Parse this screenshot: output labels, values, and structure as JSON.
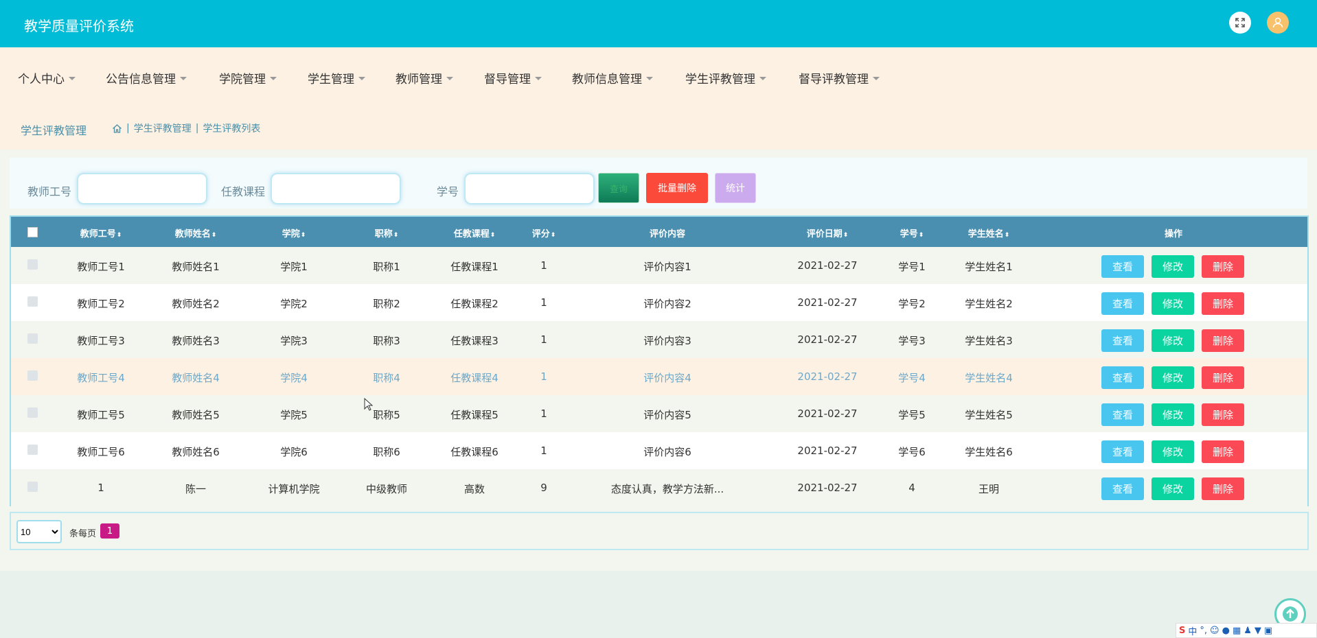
{
  "app": {
    "title": "教学质量评价系统"
  },
  "nav": [
    {
      "label": "个人中心"
    },
    {
      "label": "公告信息管理"
    },
    {
      "label": "学院管理"
    },
    {
      "label": "学生管理"
    },
    {
      "label": "教师管理"
    },
    {
      "label": "督导管理"
    },
    {
      "label": "教师信息管理"
    },
    {
      "label": "学生评教管理"
    },
    {
      "label": "督导评教管理"
    }
  ],
  "breadcrumb": {
    "title": "学生评教管理",
    "level1": "学生评教管理",
    "level2": "学生评教列表"
  },
  "search": {
    "teacher_no_label": "教师工号",
    "course_label": "任教课程",
    "student_no_label": "学号",
    "query_label": "查询",
    "batch_delete_label": "批量删除",
    "stats_label": "统计"
  },
  "table": {
    "headers": {
      "teacher_no": "教师工号",
      "teacher_name": "教师姓名",
      "college": "学院",
      "title": "职称",
      "course": "任教课程",
      "score": "评分",
      "content": "评价内容",
      "date": "评价日期",
      "student_no": "学号",
      "student_name": "学生姓名",
      "actions": "操作"
    },
    "actions": {
      "view": "查看",
      "edit": "修改",
      "delete": "删除"
    },
    "rows": [
      {
        "teacher_no": "教师工号1",
        "teacher_name": "教师姓名1",
        "college": "学院1",
        "title": "职称1",
        "course": "任教课程1",
        "score": "1",
        "content": "评价内容1",
        "date": "2021-02-27",
        "student_no": "学号1",
        "student_name": "学生姓名1"
      },
      {
        "teacher_no": "教师工号2",
        "teacher_name": "教师姓名2",
        "college": "学院2",
        "title": "职称2",
        "course": "任教课程2",
        "score": "1",
        "content": "评价内容2",
        "date": "2021-02-27",
        "student_no": "学号2",
        "student_name": "学生姓名2"
      },
      {
        "teacher_no": "教师工号3",
        "teacher_name": "教师姓名3",
        "college": "学院3",
        "title": "职称3",
        "course": "任教课程3",
        "score": "1",
        "content": "评价内容3",
        "date": "2021-02-27",
        "student_no": "学号3",
        "student_name": "学生姓名3"
      },
      {
        "teacher_no": "教师工号4",
        "teacher_name": "教师姓名4",
        "college": "学院4",
        "title": "职称4",
        "course": "任教课程4",
        "score": "1",
        "content": "评价内容4",
        "date": "2021-02-27",
        "student_no": "学号4",
        "student_name": "学生姓名4"
      },
      {
        "teacher_no": "教师工号5",
        "teacher_name": "教师姓名5",
        "college": "学院5",
        "title": "职称5",
        "course": "任教课程5",
        "score": "1",
        "content": "评价内容5",
        "date": "2021-02-27",
        "student_no": "学号5",
        "student_name": "学生姓名5"
      },
      {
        "teacher_no": "教师工号6",
        "teacher_name": "教师姓名6",
        "college": "学院6",
        "title": "职称6",
        "course": "任教课程6",
        "score": "1",
        "content": "评价内容6",
        "date": "2021-02-27",
        "student_no": "学号6",
        "student_name": "学生姓名6"
      },
      {
        "teacher_no": "1",
        "teacher_name": "陈一",
        "college": "计算机学院",
        "title": "中级教师",
        "course": "高数",
        "score": "9",
        "content": "态度认真，教学方法新...",
        "date": "2021-02-27",
        "student_no": "4",
        "student_name": "王明"
      }
    ]
  },
  "pagination": {
    "page_size": "10",
    "per_page_label": "条每页",
    "current_page": "1"
  },
  "colors": {
    "topbar": "#00bcd6",
    "header_row": "#4a8fb0",
    "view": "#48c6f0",
    "edit": "#0cd4a0",
    "delete": "#fb4a55",
    "page_active": "#c81b86"
  }
}
